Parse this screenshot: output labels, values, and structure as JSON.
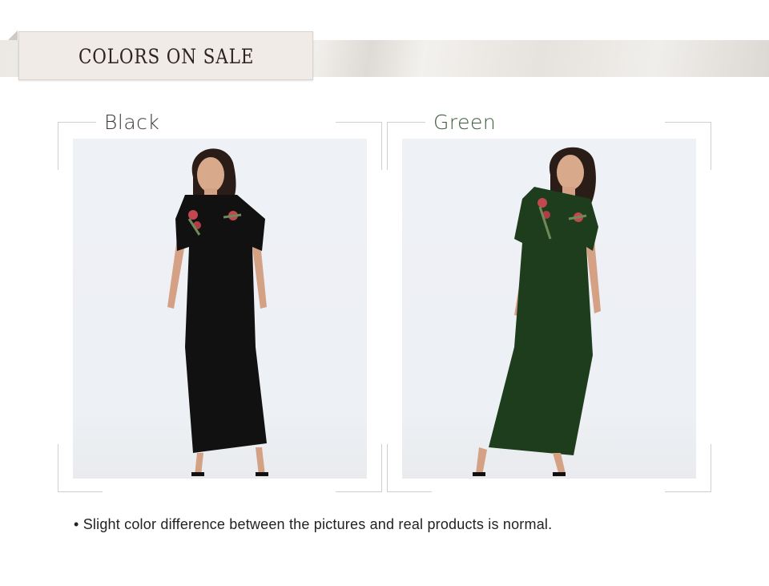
{
  "header": {
    "title": "COLORS ON SALE"
  },
  "products": [
    {
      "color_name": "Black",
      "dress_color": "#111111",
      "label_color": "#3a3a3a"
    },
    {
      "color_name": "Green",
      "dress_color": "#1d3d1d",
      "label_color": "#3a5a3a"
    }
  ],
  "note": {
    "bullet": "•",
    "text": "Slight color difference between the pictures and real products is normal."
  },
  "colors": {
    "ribbon": "#ece9e5",
    "title_box": "#f0ebe7",
    "photo_bg": "#eef1f6",
    "embroidery_red": "#c2484f",
    "embroidery_green": "#6f8a5a"
  }
}
